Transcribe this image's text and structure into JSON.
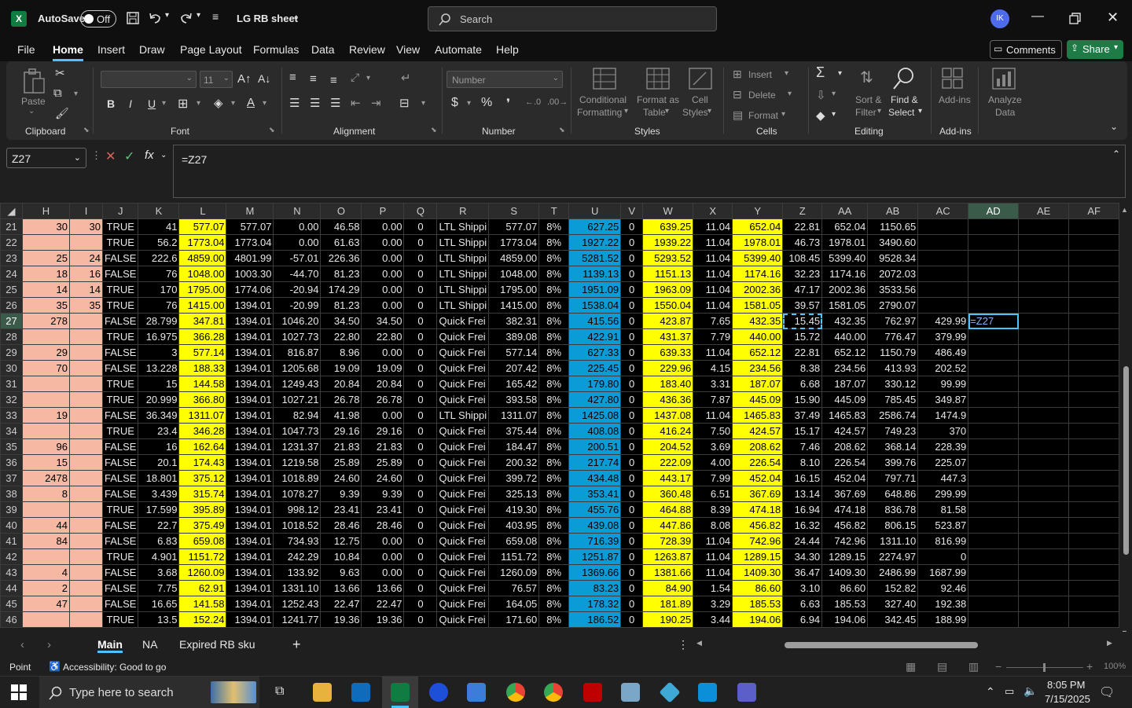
{
  "titlebar": {
    "autosave": "AutoSave",
    "toggle": "Off",
    "file_title": "LG RB sheet",
    "search_placeholder": "Search",
    "avatar": "IK"
  },
  "menu": [
    "File",
    "Home",
    "Insert",
    "Draw",
    "Page Layout",
    "Formulas",
    "Data",
    "Review",
    "View",
    "Automate",
    "Help"
  ],
  "menu_active": "Home",
  "actions": {
    "comments": "Comments",
    "share": "Share"
  },
  "ribbon": {
    "clipboard": {
      "paste": "Paste",
      "label": "Clipboard"
    },
    "font": {
      "size": "11",
      "label": "Font",
      "bold": "B",
      "italic": "I",
      "underline": "U"
    },
    "alignment": {
      "label": "Alignment"
    },
    "number": {
      "format": "Number",
      "label": "Number",
      "pct": "%"
    },
    "styles": {
      "cond1": "Conditional",
      "cond2": "Formatting",
      "fmt1": "Format as",
      "fmt2": "Table",
      "cell1": "Cell",
      "cell2": "Styles",
      "label": "Styles"
    },
    "cells": {
      "insert": "Insert",
      "delete": "Delete",
      "format": "Format",
      "label": "Cells"
    },
    "editing": {
      "sort1": "Sort &",
      "sort2": "Filter",
      "find1": "Find &",
      "find2": "Select",
      "label": "Editing"
    },
    "addins": {
      "addins": "Add-ins",
      "label": "Add-ins",
      "analyze1": "Analyze",
      "analyze2": "Data"
    }
  },
  "formula": {
    "namebox": "Z27",
    "fx": "fx",
    "content": "=Z27"
  },
  "columns": [
    "H",
    "I",
    "J",
    "K",
    "L",
    "M",
    "N",
    "O",
    "P",
    "Q",
    "R",
    "S",
    "T",
    "U",
    "V",
    "W",
    "X",
    "Y",
    "Z",
    "AA",
    "AB",
    "AC",
    "AD",
    "AE",
    "AF"
  ],
  "rows": [
    {
      "n": "21",
      "H": "30",
      "I": "30",
      "J": "TRUE",
      "K": "41",
      "L": "577.07",
      "M": "577.07",
      "N": "0.00",
      "O": "46.58",
      "P": "0.00",
      "Q": "0",
      "R": "LTL Shippi",
      "S": "577.07",
      "T": "8%",
      "U": "627.25",
      "V": "0",
      "W": "639.25",
      "X": "11.04",
      "Y": "652.04",
      "Z": "22.81",
      "AA": "652.04",
      "AB": "1150.65",
      "AC": "",
      "AD": ""
    },
    {
      "n": "22",
      "H": "",
      "I": "",
      "J": "TRUE",
      "K": "56.2",
      "L": "1773.04",
      "M": "1773.04",
      "N": "0.00",
      "O": "61.63",
      "P": "0.00",
      "Q": "0",
      "R": "LTL Shippi",
      "S": "1773.04",
      "T": "8%",
      "U": "1927.22",
      "V": "0",
      "W": "1939.22",
      "X": "11.04",
      "Y": "1978.01",
      "Z": "46.73",
      "AA": "1978.01",
      "AB": "3490.60",
      "AC": "",
      "AD": ""
    },
    {
      "n": "23",
      "H": "25",
      "I": "24",
      "J": "FALSE",
      "K": "222.6",
      "L": "4859.00",
      "M": "4801.99",
      "N": "-57.01",
      "O": "226.36",
      "P": "0.00",
      "Q": "0",
      "R": "LTL Shippi",
      "S": "4859.00",
      "T": "8%",
      "U": "5281.52",
      "V": "0",
      "W": "5293.52",
      "X": "11.04",
      "Y": "5399.40",
      "Z": "108.45",
      "AA": "5399.40",
      "AB": "9528.34",
      "AC": "",
      "AD": ""
    },
    {
      "n": "24",
      "H": "18",
      "I": "16",
      "J": "FALSE",
      "K": "76",
      "L": "1048.00",
      "M": "1003.30",
      "N": "-44.70",
      "O": "81.23",
      "P": "0.00",
      "Q": "0",
      "R": "LTL Shippi",
      "S": "1048.00",
      "T": "8%",
      "U": "1139.13",
      "V": "0",
      "W": "1151.13",
      "X": "11.04",
      "Y": "1174.16",
      "Z": "32.23",
      "AA": "1174.16",
      "AB": "2072.03",
      "AC": "",
      "AD": ""
    },
    {
      "n": "25",
      "H": "14",
      "I": "14",
      "J": "TRUE",
      "K": "170",
      "L": "1795.00",
      "M": "1774.06",
      "N": "-20.94",
      "O": "174.29",
      "P": "0.00",
      "Q": "0",
      "R": "LTL Shippi",
      "S": "1795.00",
      "T": "8%",
      "U": "1951.09",
      "V": "0",
      "W": "1963.09",
      "X": "11.04",
      "Y": "2002.36",
      "Z": "47.17",
      "AA": "2002.36",
      "AB": "3533.56",
      "AC": "",
      "AD": ""
    },
    {
      "n": "26",
      "H": "35",
      "I": "35",
      "J": "TRUE",
      "K": "76",
      "L": "1415.00",
      "M": "1394.01",
      "N": "-20.99",
      "O": "81.23",
      "P": "0.00",
      "Q": "0",
      "R": "LTL Shippi",
      "S": "1415.00",
      "T": "8%",
      "U": "1538.04",
      "V": "0",
      "W": "1550.04",
      "X": "11.04",
      "Y": "1581.05",
      "Z": "39.57",
      "AA": "1581.05",
      "AB": "2790.07",
      "AC": "",
      "AD": ""
    },
    {
      "n": "27",
      "H": "278",
      "I": "",
      "J": "FALSE",
      "K": "28.799",
      "L": "347.81",
      "M": "1394.01",
      "N": "1046.20",
      "O": "34.50",
      "P": "34.50",
      "Q": "0",
      "R": "Quick Frei",
      "S": "382.31",
      "T": "8%",
      "U": "415.56",
      "V": "0",
      "W": "423.87",
      "X": "7.65",
      "Y": "432.35",
      "Z": "15.45",
      "AA": "432.35",
      "AB": "762.97",
      "AC": "429.99",
      "AD": "=Z27"
    },
    {
      "n": "28",
      "H": "",
      "I": "",
      "J": "TRUE",
      "K": "16.975",
      "L": "366.28",
      "M": "1394.01",
      "N": "1027.73",
      "O": "22.80",
      "P": "22.80",
      "Q": "0",
      "R": "Quick Frei",
      "S": "389.08",
      "T": "8%",
      "U": "422.91",
      "V": "0",
      "W": "431.37",
      "X": "7.79",
      "Y": "440.00",
      "Z": "15.72",
      "AA": "440.00",
      "AB": "776.47",
      "AC": "379.99",
      "AD": ""
    },
    {
      "n": "29",
      "H": "29",
      "I": "",
      "J": "FALSE",
      "K": "3",
      "L": "577.14",
      "M": "1394.01",
      "N": "816.87",
      "O": "8.96",
      "P": "0.00",
      "Q": "0",
      "R": "Quick Frei",
      "S": "577.14",
      "T": "8%",
      "U": "627.33",
      "V": "0",
      "W": "639.33",
      "X": "11.04",
      "Y": "652.12",
      "Z": "22.81",
      "AA": "652.12",
      "AB": "1150.79",
      "AC": "486.49",
      "AD": ""
    },
    {
      "n": "30",
      "H": "70",
      "I": "",
      "J": "FALSE",
      "K": "13.228",
      "L": "188.33",
      "M": "1394.01",
      "N": "1205.68",
      "O": "19.09",
      "P": "19.09",
      "Q": "0",
      "R": "Quick Frei",
      "S": "207.42",
      "T": "8%",
      "U": "225.45",
      "V": "0",
      "W": "229.96",
      "X": "4.15",
      "Y": "234.56",
      "Z": "8.38",
      "AA": "234.56",
      "AB": "413.93",
      "AC": "202.52",
      "AD": ""
    },
    {
      "n": "31",
      "H": "",
      "I": "",
      "J": "TRUE",
      "K": "15",
      "L": "144.58",
      "M": "1394.01",
      "N": "1249.43",
      "O": "20.84",
      "P": "20.84",
      "Q": "0",
      "R": "Quick Frei",
      "S": "165.42",
      "T": "8%",
      "U": "179.80",
      "V": "0",
      "W": "183.40",
      "X": "3.31",
      "Y": "187.07",
      "Z": "6.68",
      "AA": "187.07",
      "AB": "330.12",
      "AC": "99.99",
      "AD": ""
    },
    {
      "n": "32",
      "H": "",
      "I": "",
      "J": "TRUE",
      "K": "20.999",
      "L": "366.80",
      "M": "1394.01",
      "N": "1027.21",
      "O": "26.78",
      "P": "26.78",
      "Q": "0",
      "R": "Quick Frei",
      "S": "393.58",
      "T": "8%",
      "U": "427.80",
      "V": "0",
      "W": "436.36",
      "X": "7.87",
      "Y": "445.09",
      "Z": "15.90",
      "AA": "445.09",
      "AB": "785.45",
      "AC": "349.87",
      "AD": ""
    },
    {
      "n": "33",
      "H": "19",
      "I": "",
      "J": "FALSE",
      "K": "36.349",
      "L": "1311.07",
      "M": "1394.01",
      "N": "82.94",
      "O": "41.98",
      "P": "0.00",
      "Q": "0",
      "R": "LTL Shippi",
      "S": "1311.07",
      "T": "8%",
      "U": "1425.08",
      "V": "0",
      "W": "1437.08",
      "X": "11.04",
      "Y": "1465.83",
      "Z": "37.49",
      "AA": "1465.83",
      "AB": "2586.74",
      "AC": "1474.9",
      "AD": ""
    },
    {
      "n": "34",
      "H": "",
      "I": "",
      "J": "TRUE",
      "K": "23.4",
      "L": "346.28",
      "M": "1394.01",
      "N": "1047.73",
      "O": "29.16",
      "P": "29.16",
      "Q": "0",
      "R": "Quick Frei",
      "S": "375.44",
      "T": "8%",
      "U": "408.08",
      "V": "0",
      "W": "416.24",
      "X": "7.50",
      "Y": "424.57",
      "Z": "15.17",
      "AA": "424.57",
      "AB": "749.23",
      "AC": "370",
      "AD": ""
    },
    {
      "n": "35",
      "H": "96",
      "I": "",
      "J": "FALSE",
      "K": "16",
      "L": "162.64",
      "M": "1394.01",
      "N": "1231.37",
      "O": "21.83",
      "P": "21.83",
      "Q": "0",
      "R": "Quick Frei",
      "S": "184.47",
      "T": "8%",
      "U": "200.51",
      "V": "0",
      "W": "204.52",
      "X": "3.69",
      "Y": "208.62",
      "Z": "7.46",
      "AA": "208.62",
      "AB": "368.14",
      "AC": "228.39",
      "AD": ""
    },
    {
      "n": "36",
      "H": "15",
      "I": "",
      "J": "FALSE",
      "K": "20.1",
      "L": "174.43",
      "M": "1394.01",
      "N": "1219.58",
      "O": "25.89",
      "P": "25.89",
      "Q": "0",
      "R": "Quick Frei",
      "S": "200.32",
      "T": "8%",
      "U": "217.74",
      "V": "0",
      "W": "222.09",
      "X": "4.00",
      "Y": "226.54",
      "Z": "8.10",
      "AA": "226.54",
      "AB": "399.76",
      "AC": "225.07",
      "AD": ""
    },
    {
      "n": "37",
      "H": "2478",
      "I": "",
      "J": "FALSE",
      "K": "18.801",
      "L": "375.12",
      "M": "1394.01",
      "N": "1018.89",
      "O": "24.60",
      "P": "24.60",
      "Q": "0",
      "R": "Quick Frei",
      "S": "399.72",
      "T": "8%",
      "U": "434.48",
      "V": "0",
      "W": "443.17",
      "X": "7.99",
      "Y": "452.04",
      "Z": "16.15",
      "AA": "452.04",
      "AB": "797.71",
      "AC": "447.3",
      "AD": ""
    },
    {
      "n": "38",
      "H": "8",
      "I": "",
      "J": "FALSE",
      "K": "3.439",
      "L": "315.74",
      "M": "1394.01",
      "N": "1078.27",
      "O": "9.39",
      "P": "9.39",
      "Q": "0",
      "R": "Quick Frei",
      "S": "325.13",
      "T": "8%",
      "U": "353.41",
      "V": "0",
      "W": "360.48",
      "X": "6.51",
      "Y": "367.69",
      "Z": "13.14",
      "AA": "367.69",
      "AB": "648.86",
      "AC": "299.99",
      "AD": ""
    },
    {
      "n": "39",
      "H": "",
      "I": "",
      "J": "TRUE",
      "K": "17.599",
      "L": "395.89",
      "M": "1394.01",
      "N": "998.12",
      "O": "23.41",
      "P": "23.41",
      "Q": "0",
      "R": "Quick Frei",
      "S": "419.30",
      "T": "8%",
      "U": "455.76",
      "V": "0",
      "W": "464.88",
      "X": "8.39",
      "Y": "474.18",
      "Z": "16.94",
      "AA": "474.18",
      "AB": "836.78",
      "AC": "81.58",
      "AD": ""
    },
    {
      "n": "40",
      "H": "44",
      "I": "",
      "J": "FALSE",
      "K": "22.7",
      "L": "375.49",
      "M": "1394.01",
      "N": "1018.52",
      "O": "28.46",
      "P": "28.46",
      "Q": "0",
      "R": "Quick Frei",
      "S": "403.95",
      "T": "8%",
      "U": "439.08",
      "V": "0",
      "W": "447.86",
      "X": "8.08",
      "Y": "456.82",
      "Z": "16.32",
      "AA": "456.82",
      "AB": "806.15",
      "AC": "523.87",
      "AD": ""
    },
    {
      "n": "41",
      "H": "84",
      "I": "",
      "J": "FALSE",
      "K": "6.83",
      "L": "659.08",
      "M": "1394.01",
      "N": "734.93",
      "O": "12.75",
      "P": "0.00",
      "Q": "0",
      "R": "Quick Frei",
      "S": "659.08",
      "T": "8%",
      "U": "716.39",
      "V": "0",
      "W": "728.39",
      "X": "11.04",
      "Y": "742.96",
      "Z": "24.44",
      "AA": "742.96",
      "AB": "1311.10",
      "AC": "816.99",
      "AD": ""
    },
    {
      "n": "42",
      "H": "",
      "I": "",
      "J": "TRUE",
      "K": "4.901",
      "L": "1151.72",
      "M": "1394.01",
      "N": "242.29",
      "O": "10.84",
      "P": "0.00",
      "Q": "0",
      "R": "Quick Frei",
      "S": "1151.72",
      "T": "8%",
      "U": "1251.87",
      "V": "0",
      "W": "1263.87",
      "X": "11.04",
      "Y": "1289.15",
      "Z": "34.30",
      "AA": "1289.15",
      "AB": "2274.97",
      "AC": "0",
      "AD": ""
    },
    {
      "n": "43",
      "H": "4",
      "I": "",
      "J": "FALSE",
      "K": "3.68",
      "L": "1260.09",
      "M": "1394.01",
      "N": "133.92",
      "O": "9.63",
      "P": "0.00",
      "Q": "0",
      "R": "Quick Frei",
      "S": "1260.09",
      "T": "8%",
      "U": "1369.66",
      "V": "0",
      "W": "1381.66",
      "X": "11.04",
      "Y": "1409.30",
      "Z": "36.47",
      "AA": "1409.30",
      "AB": "2486.99",
      "AC": "1687.99",
      "AD": ""
    },
    {
      "n": "44",
      "H": "2",
      "I": "",
      "J": "FALSE",
      "K": "7.75",
      "L": "62.91",
      "M": "1394.01",
      "N": "1331.10",
      "O": "13.66",
      "P": "13.66",
      "Q": "0",
      "R": "Quick Frei",
      "S": "76.57",
      "T": "8%",
      "U": "83.23",
      "V": "0",
      "W": "84.90",
      "X": "1.54",
      "Y": "86.60",
      "Z": "3.10",
      "AA": "86.60",
      "AB": "152.82",
      "AC": "92.46",
      "AD": ""
    },
    {
      "n": "45",
      "H": "47",
      "I": "",
      "J": "FALSE",
      "K": "16.65",
      "L": "141.58",
      "M": "1394.01",
      "N": "1252.43",
      "O": "22.47",
      "P": "22.47",
      "Q": "0",
      "R": "Quick Frei",
      "S": "164.05",
      "T": "8%",
      "U": "178.32",
      "V": "0",
      "W": "181.89",
      "X": "3.29",
      "Y": "185.53",
      "Z": "6.63",
      "AA": "185.53",
      "AB": "327.40",
      "AC": "192.38",
      "AD": ""
    },
    {
      "n": "46",
      "H": "",
      "I": "",
      "J": "TRUE",
      "K": "13.5",
      "L": "152.24",
      "M": "1394.01",
      "N": "1241.77",
      "O": "19.36",
      "P": "19.36",
      "Q": "0",
      "R": "Quick Frei",
      "S": "171.60",
      "T": "8%",
      "U": "186.52",
      "V": "0",
      "W": "190.25",
      "X": "3.44",
      "Y": "194.06",
      "Z": "6.94",
      "AA": "194.06",
      "AB": "342.45",
      "AC": "188.99",
      "AD": ""
    }
  ],
  "sheets": [
    "Main",
    "NA",
    "Expired RB sku"
  ],
  "active_sheet": "Main",
  "status": {
    "mode": "Point",
    "accessibility": "Accessibility: Good to go",
    "zoom": "100%"
  },
  "taskbar": {
    "search": "Type here to search",
    "time": "8:05 PM",
    "date": "7/15/2025"
  },
  "colors": {
    "pink": "#f6b7a3",
    "yellow": "#ffff00",
    "blue": "#0b9bd6",
    "accent": "#4cc2ff",
    "excel_green": "#107c41"
  }
}
